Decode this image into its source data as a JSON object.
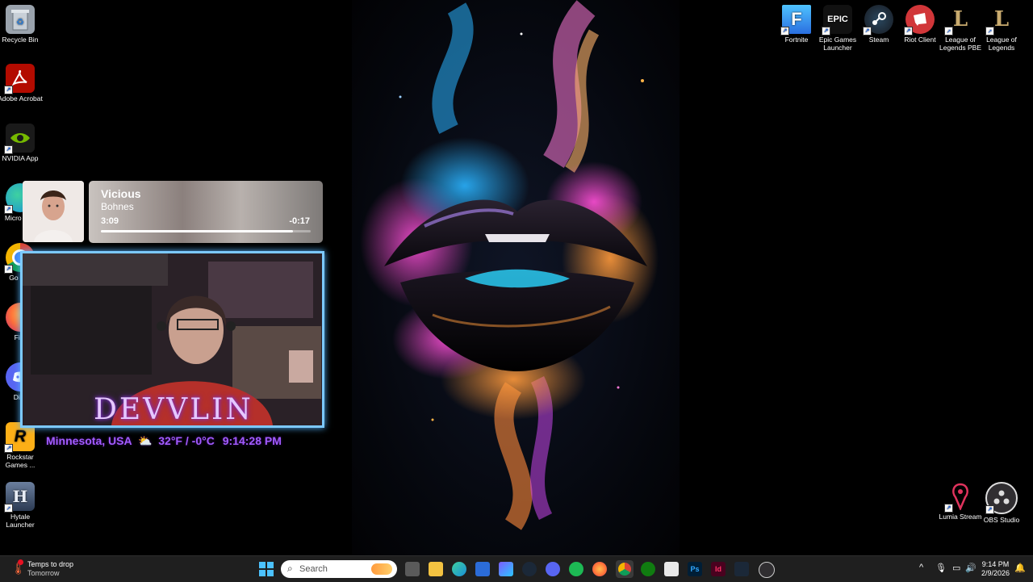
{
  "desktop_left": [
    {
      "label": "Recycle Bin",
      "icon": "recycle-bin-icon",
      "color": "#9aa3ad"
    },
    {
      "label": "Adobe Acrobat",
      "icon": "acrobat-icon",
      "color": "#b30b00"
    },
    {
      "label": "NVIDIA App",
      "icon": "nvidia-icon",
      "color": "#76b900"
    },
    {
      "label": "Micro Edg",
      "icon": "edge-icon",
      "color": "#1a8fd8"
    },
    {
      "label": "Go Chr",
      "icon": "chrome-icon",
      "color": "#db4437"
    },
    {
      "label": "Fire",
      "icon": "firefox-icon",
      "color": "#ff7139"
    },
    {
      "label": "Disc",
      "icon": "discord-icon",
      "color": "#5865f2"
    },
    {
      "label": "Rockstar Games ...",
      "icon": "rockstar-icon",
      "color": "#fcaf17"
    },
    {
      "label": "Hytale Launcher",
      "icon": "hytale-icon",
      "color": "#2b3a52"
    }
  ],
  "desktop_right": [
    {
      "label": "Fortnite",
      "icon": "fortnite-icon",
      "color": "#2a8ef0"
    },
    {
      "label": "Epic Games Launcher",
      "icon": "epic-games-icon",
      "color": "#1b1b1b"
    },
    {
      "label": "Steam",
      "icon": "steam-icon",
      "color": "#1b2838"
    },
    {
      "label": "Riot Client",
      "icon": "riot-client-icon",
      "color": "#d13639"
    },
    {
      "label": "League of Legends PBE",
      "icon": "league-pbe-icon",
      "color": "#c8aa6e"
    },
    {
      "label": "League of Legends",
      "icon": "league-icon",
      "color": "#c8aa6e"
    },
    {
      "label": "Lumia Stream",
      "icon": "lumia-stream-icon",
      "color": "#e0335d"
    },
    {
      "label": "OBS Studio",
      "icon": "obs-icon",
      "color": "#302e31"
    }
  ],
  "media": {
    "title": "Vicious",
    "artist": "Bohnes",
    "elapsed": "3:09",
    "remaining": "-0:17",
    "progress": 0.917
  },
  "overlay": {
    "name": "DEVVLIN",
    "location": "Minnesota, USA",
    "temp": "32°F / -0°C",
    "time": "9:14:28 PM"
  },
  "taskbar": {
    "weather_title": "Temps to drop",
    "weather_sub": "Tomorrow",
    "search_placeholder": "Search",
    "clock_time": "9:14 PM",
    "clock_date": "2/9/2026"
  }
}
